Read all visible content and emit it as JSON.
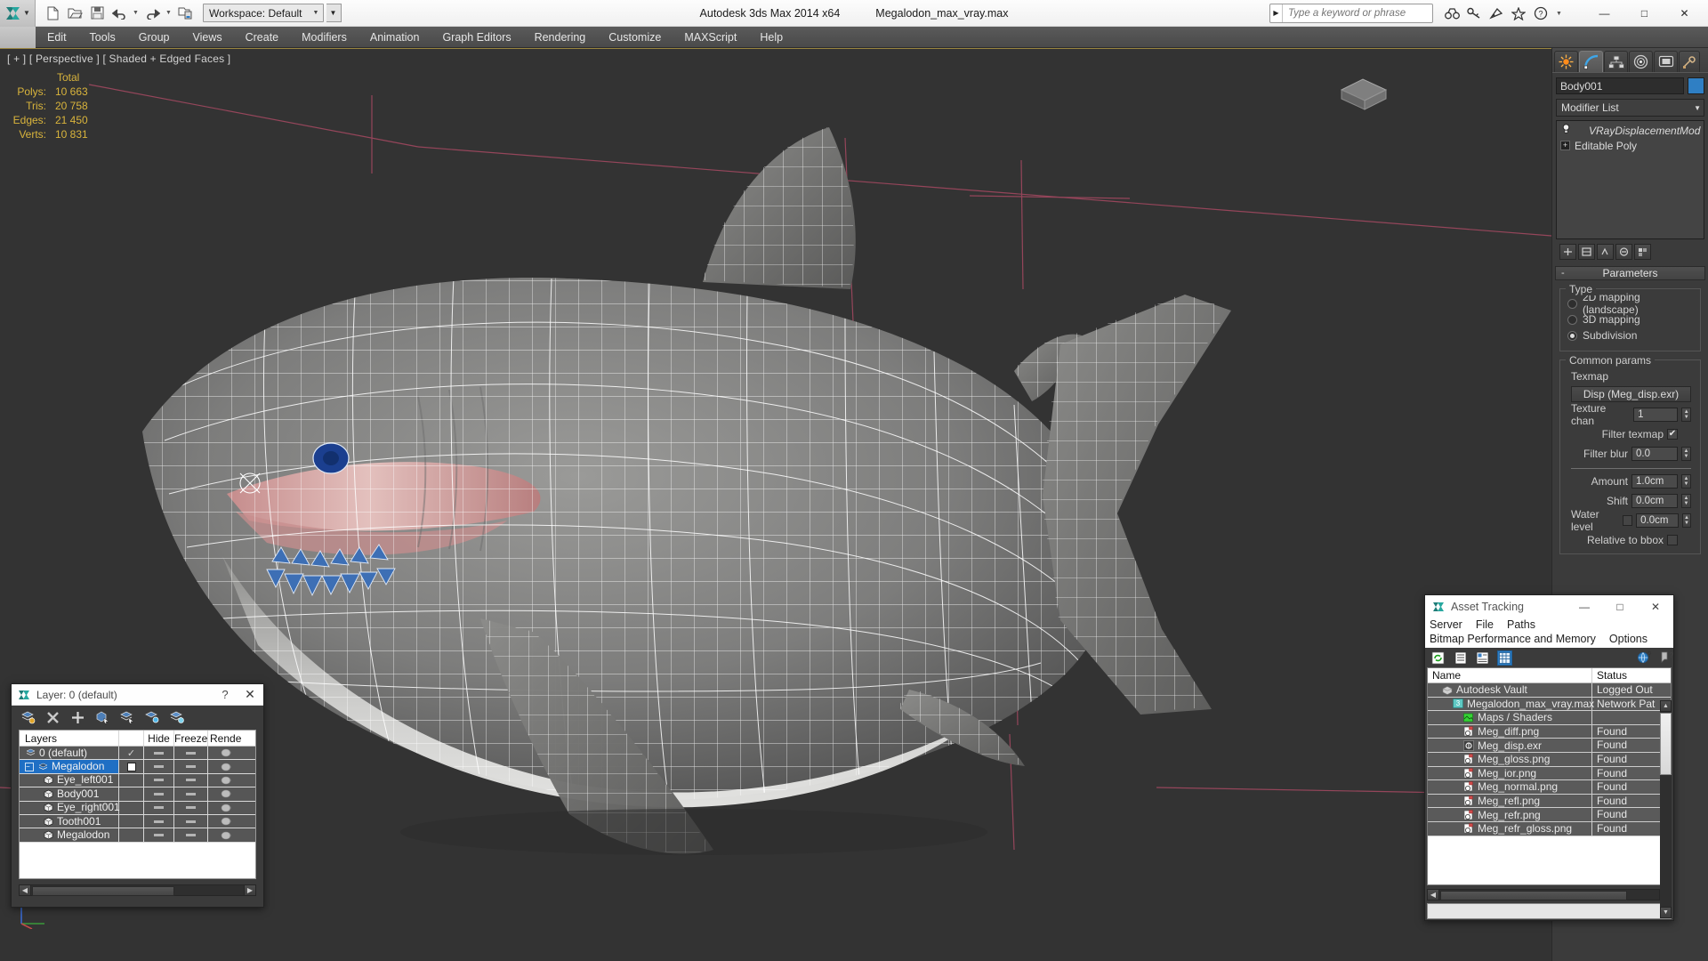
{
  "titlebar": {
    "app_title": "Autodesk 3ds Max  2014 x64",
    "file_name": "Megalodon_max_vray.max",
    "workspace": "Workspace: Default",
    "search_placeholder": "Type a keyword or phrase",
    "qat": [
      {
        "name": "new-file-icon",
        "label": "New"
      },
      {
        "name": "open-file-icon",
        "label": "Open"
      },
      {
        "name": "save-file-icon",
        "label": "Save"
      },
      {
        "name": "undo-icon",
        "label": "Undo"
      },
      {
        "name": "redo-icon",
        "label": "Redo"
      },
      {
        "name": "set-project-folder-icon",
        "label": "Set Project Folder"
      }
    ],
    "help_icons": [
      {
        "name": "binoculars-icon",
        "label": "Search"
      },
      {
        "name": "key-icon",
        "label": "Keyboard Shortcut"
      },
      {
        "name": "satellite-dish-icon",
        "label": "Communication Center"
      },
      {
        "name": "star-icon",
        "label": "Favorites"
      },
      {
        "name": "help-icon",
        "label": "Help"
      }
    ],
    "window_buttons": [
      {
        "name": "minimize-button",
        "glyph": "—"
      },
      {
        "name": "maximize-button",
        "glyph": "□"
      },
      {
        "name": "close-button",
        "glyph": "✕"
      }
    ]
  },
  "menubar": {
    "items": [
      "Edit",
      "Tools",
      "Group",
      "Views",
      "Create",
      "Modifiers",
      "Animation",
      "Graph Editors",
      "Rendering",
      "Customize",
      "MAXScript",
      "Help"
    ]
  },
  "viewport": {
    "label": "[ + ] [ Perspective ] [ Shaded + Edged Faces ]",
    "stats": {
      "column_header": "Total",
      "rows": [
        {
          "label": "Polys:",
          "value": "10 663"
        },
        {
          "label": "Tris:",
          "value": "20 758"
        },
        {
          "label": "Edges:",
          "value": "21 450"
        },
        {
          "label": "Verts:",
          "value": "10 831"
        }
      ]
    },
    "stats_color": "#d9b43c",
    "grid_color": "#a14f63",
    "background_color": "#333333"
  },
  "command_panel": {
    "tabs": [
      {
        "name": "create-tab",
        "label": "Create"
      },
      {
        "name": "modify-tab",
        "label": "Modify",
        "active": true
      },
      {
        "name": "hierarchy-tab",
        "label": "Hierarchy"
      },
      {
        "name": "motion-tab",
        "label": "Motion"
      },
      {
        "name": "display-tab",
        "label": "Display"
      },
      {
        "name": "utilities-tab",
        "label": "Utilities"
      }
    ],
    "object_name": "Body001",
    "object_color": "#2f7fc4",
    "modifier_list_label": "Modifier List",
    "stack": [
      {
        "name": "VRayDisplacementMod",
        "italic": true
      },
      {
        "name": "Editable Poly",
        "italic": false
      }
    ],
    "stack_tools": [
      {
        "name": "pin-stack-icon"
      },
      {
        "name": "show-end-result-icon"
      },
      {
        "name": "make-unique-icon"
      },
      {
        "name": "remove-modifier-icon"
      },
      {
        "name": "configure-modifier-sets-icon"
      }
    ],
    "parameters": {
      "rollout_title": "Parameters",
      "type_group": {
        "title": "Type",
        "options": [
          {
            "label": "2D mapping (landscape)",
            "selected": false
          },
          {
            "label": "3D mapping",
            "selected": false
          },
          {
            "label": "Subdivision",
            "selected": true
          }
        ]
      },
      "common_params": {
        "title": "Common params",
        "texmap_label": "Texmap",
        "texmap_button": "Disp (Meg_disp.exr)",
        "texture_chan_label": "Texture chan",
        "texture_chan_value": "1",
        "filter_texmap_label": "Filter texmap",
        "filter_texmap_checked": true,
        "filter_blur_label": "Filter blur",
        "filter_blur_value": "0.0",
        "amount_label": "Amount",
        "amount_value": "1.0cm",
        "shift_label": "Shift",
        "shift_value": "0.0cm",
        "water_level_label": "Water level",
        "water_level_value": "0.0cm",
        "water_level_checked": false,
        "relative_to_bbox_label": "Relative to bbox",
        "relative_to_bbox_checked": false
      }
    }
  },
  "layer_dialog": {
    "title": "Layer: 0 (default)",
    "help_glyph": "?",
    "close_glyph": "✕",
    "toolbar": [
      {
        "name": "create-new-layer-icon"
      },
      {
        "name": "delete-layer-icon"
      },
      {
        "name": "add-selection-to-layer-icon"
      },
      {
        "name": "select-objects-in-layer-icon"
      },
      {
        "name": "select-highlighted-objects-icon"
      },
      {
        "name": "highlight-selected-objects-icon"
      },
      {
        "name": "layer-properties-icon"
      }
    ],
    "columns": [
      "Layers",
      "Hide",
      "Freeze",
      "Rende"
    ],
    "rows": [
      {
        "name": "0 (default)",
        "indent": 0,
        "type": "layer",
        "current": true,
        "selected": false
      },
      {
        "name": "Megalodon",
        "indent": 0,
        "type": "layer",
        "current": false,
        "selected": true,
        "expander": "-"
      },
      {
        "name": "Eye_left001",
        "indent": 1,
        "type": "object"
      },
      {
        "name": "Body001",
        "indent": 1,
        "type": "object"
      },
      {
        "name": "Eye_right001",
        "indent": 1,
        "type": "object"
      },
      {
        "name": "Tooth001",
        "indent": 1,
        "type": "object"
      },
      {
        "name": "Megalodon",
        "indent": 1,
        "type": "object"
      }
    ]
  },
  "asset_tracking": {
    "title": "Asset Tracking",
    "window_buttons": [
      {
        "name": "minimize-button",
        "glyph": "—"
      },
      {
        "name": "maximize-button",
        "glyph": "□"
      },
      {
        "name": "close-button",
        "glyph": "✕"
      }
    ],
    "menus_row1": [
      "Server",
      "File",
      "Paths"
    ],
    "menus_row2": [
      "Bitmap Performance and Memory",
      "Options"
    ],
    "toolbar": [
      {
        "name": "refresh-icon"
      },
      {
        "name": "list-view-icon"
      },
      {
        "name": "detail-view-icon"
      },
      {
        "name": "grid-view-icon",
        "active": true
      },
      {
        "name": "globe-help-icon"
      },
      {
        "name": "context-help-icon"
      }
    ],
    "columns": [
      "Name",
      "Status"
    ],
    "rows": [
      {
        "name": "Autodesk Vault",
        "status": "Logged Out",
        "indent": 0,
        "icon": "vault-icon"
      },
      {
        "name": "Megalodon_max_vray.max",
        "status": "Network Pat",
        "indent": 1,
        "icon": "max-file-icon"
      },
      {
        "name": "Maps / Shaders",
        "status": "",
        "indent": 2,
        "icon": "maps-icon"
      },
      {
        "name": "Meg_diff.png",
        "status": "Found",
        "indent": 3,
        "icon": "bitmap-icon"
      },
      {
        "name": "Meg_disp.exr",
        "status": "Found",
        "indent": 3,
        "icon": "exr-icon"
      },
      {
        "name": "Meg_gloss.png",
        "status": "Found",
        "indent": 3,
        "icon": "bitmap-icon"
      },
      {
        "name": "Meg_ior.png",
        "status": "Found",
        "indent": 3,
        "icon": "bitmap-icon"
      },
      {
        "name": "Meg_normal.png",
        "status": "Found",
        "indent": 3,
        "icon": "bitmap-icon"
      },
      {
        "name": "Meg_refl.png",
        "status": "Found",
        "indent": 3,
        "icon": "bitmap-icon"
      },
      {
        "name": "Meg_refr.png",
        "status": "Found",
        "indent": 3,
        "icon": "bitmap-icon"
      },
      {
        "name": "Meg_refr_gloss.png",
        "status": "Found",
        "indent": 3,
        "icon": "bitmap-icon"
      }
    ]
  }
}
